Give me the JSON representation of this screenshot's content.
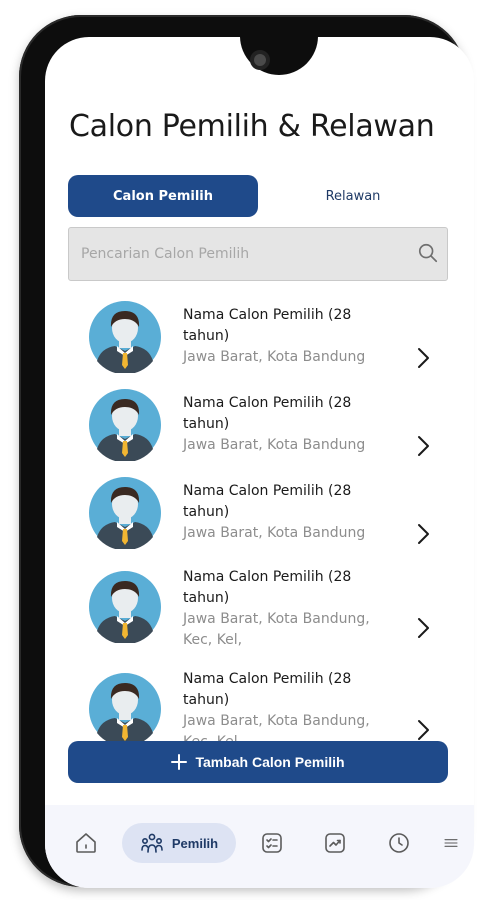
{
  "header": {
    "title": "Calon Pemilih & Relawan"
  },
  "tabs": [
    {
      "label": "Calon Pemilih",
      "active": true
    },
    {
      "label": "Relawan",
      "active": false
    }
  ],
  "search": {
    "placeholder": "Pencarian Calon Pemilih",
    "value": ""
  },
  "list": {
    "items": [
      {
        "name": "Nama Calon Pemilih (28 tahun)",
        "location": "Jawa Barat, Kota Bandung"
      },
      {
        "name": "Nama Calon Pemilih (28 tahun)",
        "location": "Jawa Barat, Kota Bandung"
      },
      {
        "name": "Nama Calon Pemilih (28 tahun)",
        "location": "Jawa Barat, Kota Bandung"
      },
      {
        "name": "Nama Calon Pemilih (28 tahun)",
        "location": "Jawa Barat, Kota Bandung, Kec, Kel,"
      },
      {
        "name": "Nama Calon Pemilih (28 tahun)",
        "location": "Jawa Barat, Kota Bandung, Kec, Kel,"
      }
    ]
  },
  "add_button": {
    "label": "Tambah Calon Pemilih"
  },
  "bottom_nav": {
    "items": [
      {
        "icon": "home-icon"
      },
      {
        "icon": "users-icon",
        "label": "Pemilih",
        "active": true
      },
      {
        "icon": "checklist-icon"
      },
      {
        "icon": "trending-icon"
      },
      {
        "icon": "clock-icon"
      },
      {
        "icon": "menu-icon"
      }
    ]
  },
  "colors": {
    "primary": "#1f4a8a",
    "nav_active_bg": "#dde3f3",
    "nav_bg": "#f5f6fc",
    "avatar_bg": "#5aaed6"
  }
}
